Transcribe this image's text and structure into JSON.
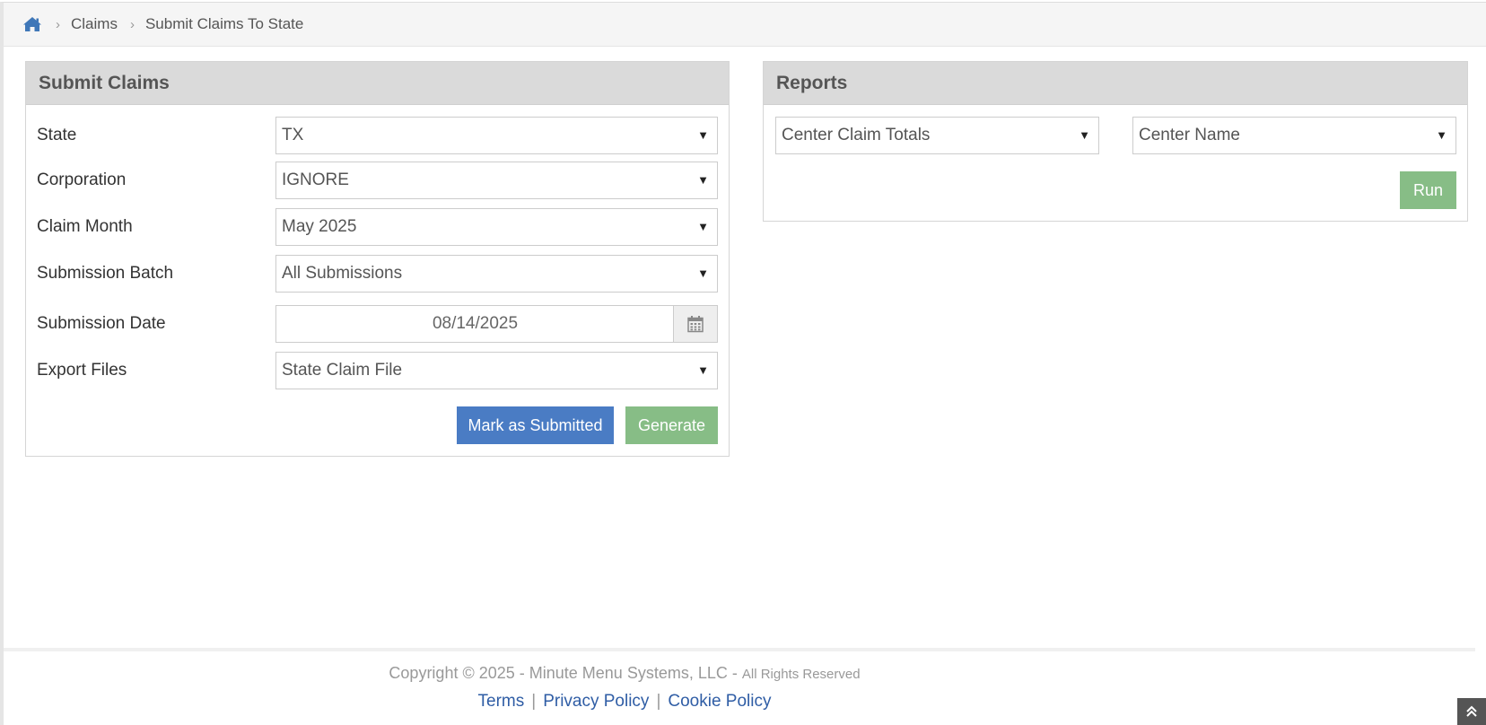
{
  "breadcrumb": {
    "home_icon": "home-icon",
    "items": [
      "Claims",
      "Submit Claims To State"
    ],
    "separator": "›"
  },
  "submit_panel": {
    "title": "Submit Claims",
    "fields": {
      "state": {
        "label": "State",
        "value": "TX"
      },
      "corporation": {
        "label": "Corporation",
        "value": "IGNORE"
      },
      "claim_month": {
        "label": "Claim Month",
        "value": "May 2025"
      },
      "submission_batch": {
        "label": "Submission Batch",
        "value": "All Submissions"
      },
      "submission_date": {
        "label": "Submission Date",
        "value": "08/14/2025"
      },
      "export_files": {
        "label": "Export Files",
        "value": "State Claim File"
      }
    },
    "mark_submitted_label": "Mark as Submitted",
    "generate_label": "Generate"
  },
  "reports_panel": {
    "title": "Reports",
    "report_type": "Center Claim Totals",
    "sort_by": "Center Name",
    "run_label": "Run"
  },
  "footer": {
    "copyright": "Copyright © 2025 - Minute Menu Systems, LLC - ",
    "rights": "All Rights Reserved",
    "links": [
      "Terms",
      "Privacy Policy",
      "Cookie Policy"
    ],
    "divider": "|"
  },
  "colors": {
    "primary_button": "#4a7cc4",
    "success_button": "#87bd86",
    "link": "#2f5da5",
    "panel_heading_bg": "#dadada"
  }
}
